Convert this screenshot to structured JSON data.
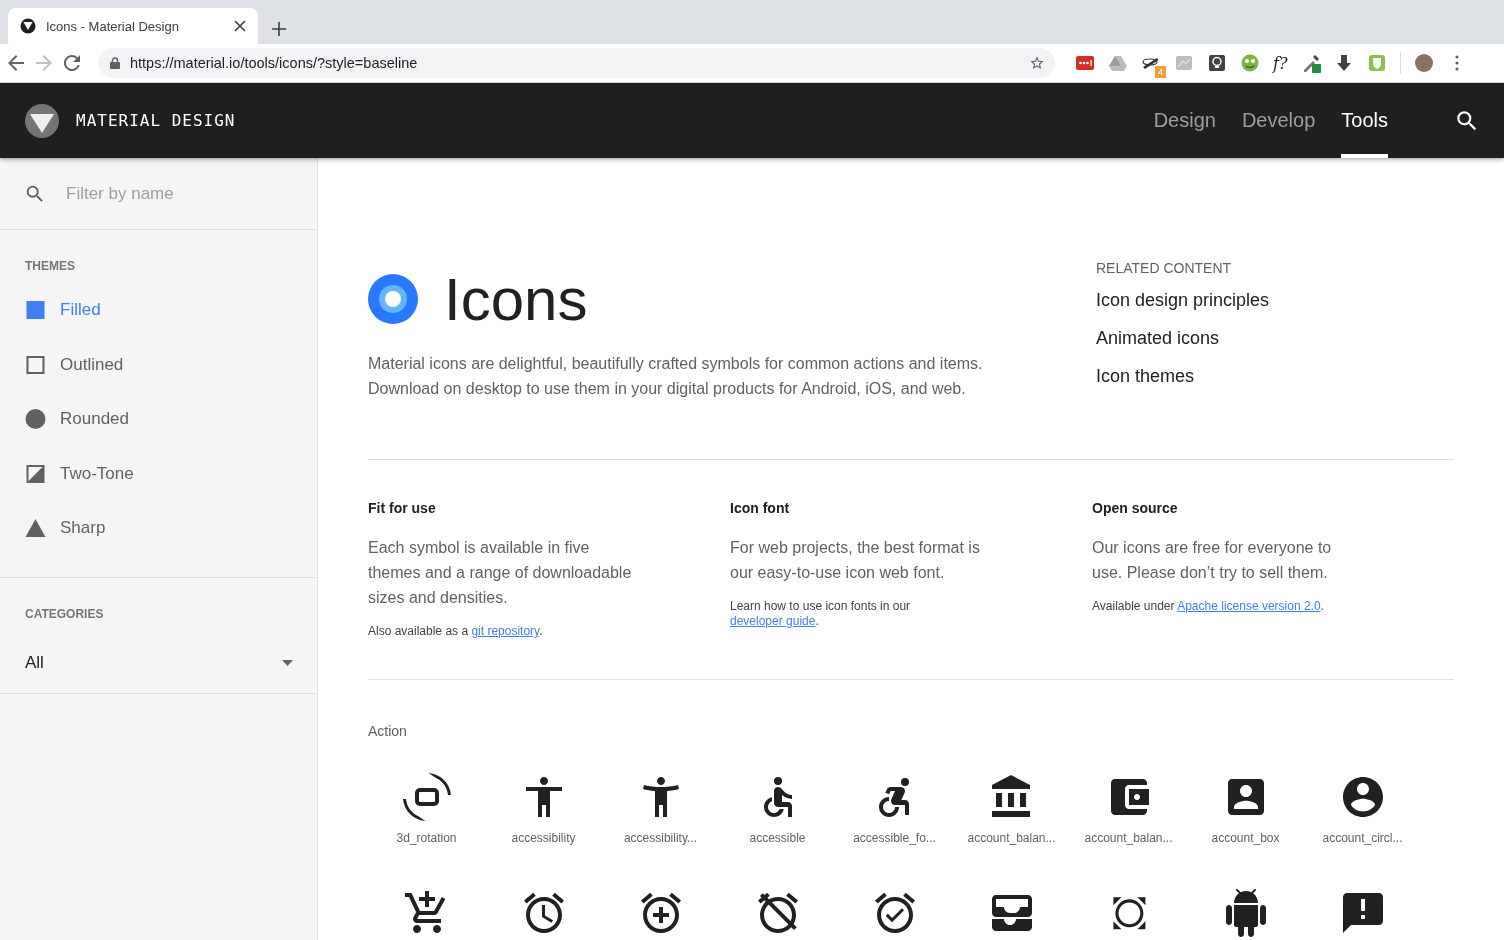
{
  "browser": {
    "tab_title": "Icons - Material Design",
    "url": "https://material.io/tools/icons/?style=baseline",
    "extensions": [
      {
        "kind": "dots"
      },
      {
        "kind": "drive"
      },
      {
        "kind": "wand",
        "badge": "4"
      },
      {
        "kind": "chart"
      },
      {
        "kind": "bulb"
      },
      {
        "kind": "face"
      },
      {
        "kind": "text",
        "label": "f?"
      },
      {
        "kind": "dropper"
      },
      {
        "kind": "download"
      },
      {
        "kind": "shield"
      },
      {
        "kind": "avatar"
      },
      {
        "kind": "menu"
      }
    ]
  },
  "header": {
    "brand": "MATERIAL DESIGN",
    "nav": [
      {
        "label": "Design",
        "selected": false
      },
      {
        "label": "Develop",
        "selected": false
      },
      {
        "label": "Tools",
        "selected": true
      }
    ]
  },
  "sidebar": {
    "filter": {
      "placeholder": "Filter by name"
    },
    "themes_heading": "THEMES",
    "themes": [
      {
        "label": "Filled",
        "kind": "filled",
        "selected": true
      },
      {
        "label": "Outlined",
        "kind": "outlined",
        "selected": false
      },
      {
        "label": "Rounded",
        "kind": "rounded",
        "selected": false
      },
      {
        "label": "Two-Tone",
        "kind": "twotone",
        "selected": false
      },
      {
        "label": "Sharp",
        "kind": "sharp",
        "selected": false
      }
    ],
    "categories_heading": "CATEGORIES",
    "category": "All"
  },
  "intro": {
    "title": "Icons",
    "description": "Material icons are delightful, beautifully crafted symbols for common actions and items. Download on desktop to use them in your digital products for Android, iOS, and web.",
    "related_heading": "RELATED CONTENT",
    "related_links": [
      "Icon design principles",
      "Animated icons",
      "Icon themes"
    ]
  },
  "features": [
    {
      "heading": "Fit for use",
      "body": "Each symbol is available in five themes and a range of downloadable sizes and densities.",
      "note_before": "Also available as a ",
      "note_link": "git repository",
      "note_after": "."
    },
    {
      "heading": "Icon font",
      "body": "For web projects, the best format is our easy-to-use icon web font.",
      "note_before": "Learn how to use icon fonts in our ",
      "note_link": "developer guide",
      "note_after": "."
    },
    {
      "heading": "Open source",
      "body": "Our icons are free for everyone to use. Please don’t try to sell them.",
      "note_before": "Available under ",
      "note_link": "Apache license version 2.0",
      "note_after": "."
    }
  ],
  "category_title": "Action",
  "icons": [
    {
      "kind": "rotation",
      "label": "3d_rotation"
    },
    {
      "kind": "accessibility",
      "label": "accessibility"
    },
    {
      "kind": "armsup",
      "label": "accessibility..."
    },
    {
      "kind": "accessible",
      "label": "accessible"
    },
    {
      "kind": "wheelchairfwd",
      "label": "accessible_fo..."
    },
    {
      "kind": "bank",
      "label": "account_balan..."
    },
    {
      "kind": "wallet",
      "label": "account_balan..."
    },
    {
      "kind": "accountbox",
      "label": "account_box"
    },
    {
      "kind": "accountcircle",
      "label": "account_circl..."
    },
    {
      "kind": "cart"
    },
    {
      "kind": "alarm"
    },
    {
      "kind": "alarmadd"
    },
    {
      "kind": "alarmoff"
    },
    {
      "kind": "alarmon"
    },
    {
      "kind": "inbox"
    },
    {
      "kind": "allout"
    },
    {
      "kind": "android"
    },
    {
      "kind": "announcement"
    }
  ]
}
